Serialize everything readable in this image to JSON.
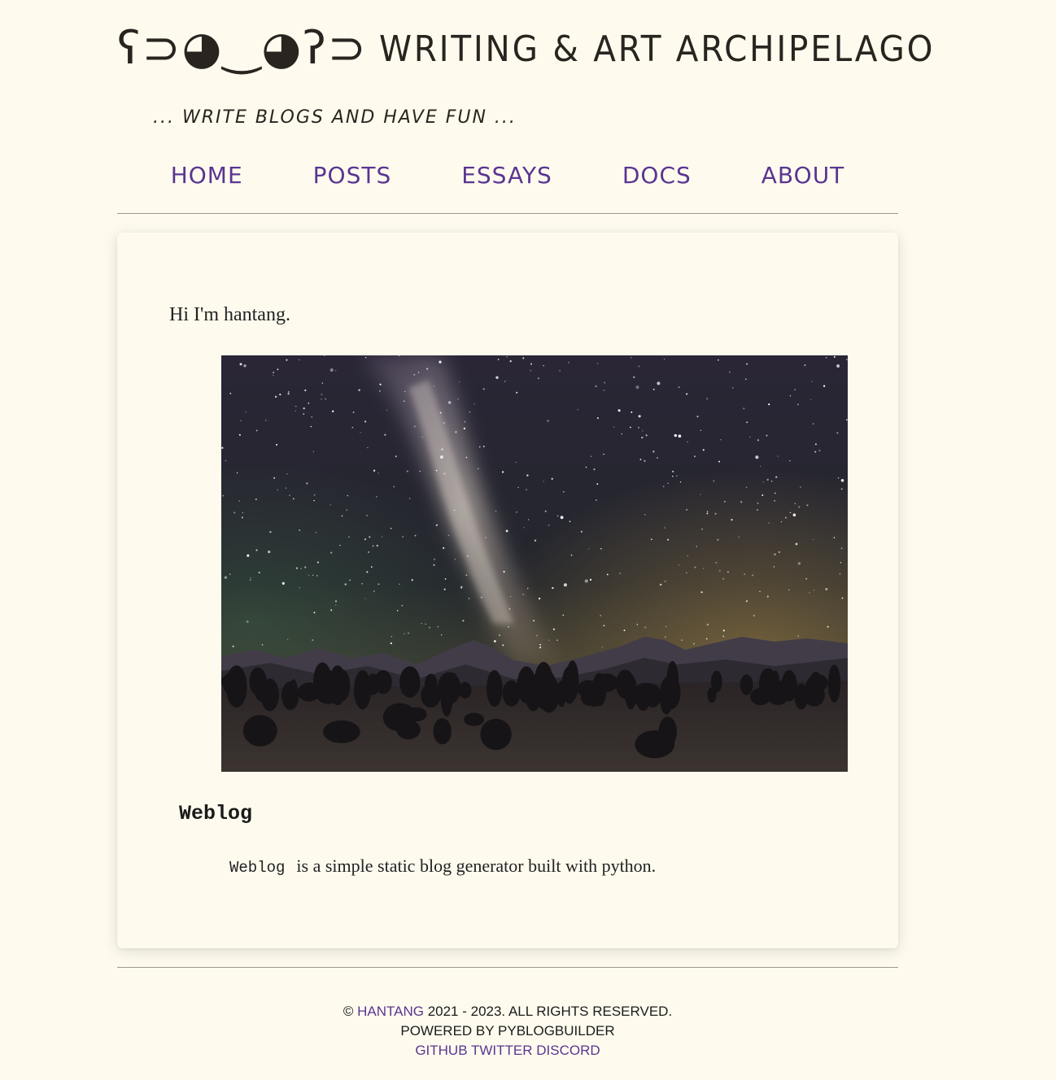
{
  "header": {
    "face": "ʕ⊃◕‿◕ʔ⊃",
    "title": "Writing & Art Archipelago",
    "tagline": "... Write blogs and have fun ..."
  },
  "nav": {
    "items": [
      {
        "label": "Home"
      },
      {
        "label": "Posts"
      },
      {
        "label": "Essays"
      },
      {
        "label": "Docs"
      },
      {
        "label": "About"
      }
    ]
  },
  "main": {
    "intro": "Hi I'm hantang.",
    "image_alt": "Milky way over mountains at night",
    "section_title": "Weblog",
    "code_term": "Weblog",
    "description": "is a simple static blog generator built with python."
  },
  "footer": {
    "copyright_symbol": "©",
    "author": "hantang",
    "years_rights": "2021 - 2023. All Rights Reserved.",
    "powered": "Powered by PyBlogBuilder",
    "links": [
      "GitHub",
      "Twitter",
      "Discord"
    ]
  },
  "colors": {
    "background": "#fefbee",
    "link": "#5a3592",
    "text": "#222222"
  }
}
